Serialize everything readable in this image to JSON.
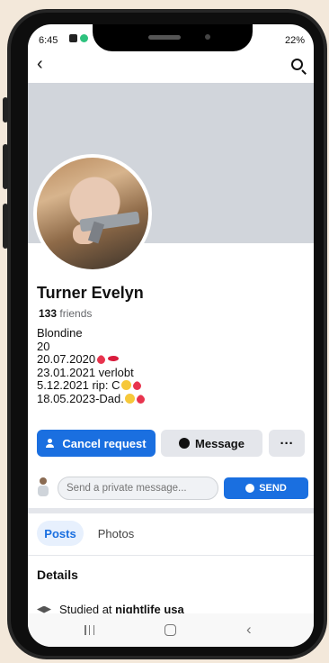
{
  "status": {
    "time": "6:45",
    "right": "·.⁺⸝ ୭ 22%"
  },
  "profile": {
    "name": "Turner Evelyn",
    "friends_count": "133",
    "friends_label": "friends",
    "bio": [
      "Blondine",
      "20",
      "20.07.2020",
      "23.01.2021 verlobt",
      "5.12.2021 rip: C",
      "18.05.2023-Dad."
    ]
  },
  "actions": {
    "cancel_label": "Cancel request",
    "message_label": "Message",
    "more_label": "···"
  },
  "composer": {
    "placeholder": "Send a private message...",
    "send_label": "SEND"
  },
  "tabs": [
    {
      "label": "Posts",
      "active": true
    },
    {
      "label": "Photos",
      "active": false
    }
  ],
  "details": {
    "title": "Details",
    "studied_prefix": "Studied at",
    "studied_place": "nightlife usa"
  },
  "colors": {
    "accent": "#1a6fe0",
    "cover": "#d1d5db",
    "frame": "#f3e8da"
  }
}
